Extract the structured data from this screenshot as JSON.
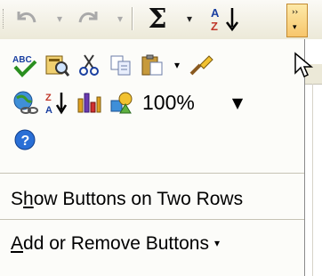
{
  "toolbar": {
    "undo_icon": "undo-icon",
    "redo_icon": "redo-icon",
    "dropdown_glyph": "▾",
    "sigma_label": "Σ",
    "sort_icon": "sort-az-icon",
    "overflow_icon": "toolbar-options-chevron-icon",
    "overflow_top": "››",
    "overflow_bottom": "▾"
  },
  "popup": {
    "row1": [
      "spelling-icon",
      "research-icon",
      "cut-icon",
      "copy-icon",
      "paste-icon",
      "format-painter-icon"
    ],
    "row2": [
      "hyperlink-icon",
      "sort-descending-icon",
      "chart-wizard-icon",
      "drawing-icon"
    ],
    "zoom_value": "100%",
    "zoom_dropdown": "▼",
    "row3": [
      "help-icon"
    ],
    "show_two_rows": {
      "pre": "S",
      "ul": "h",
      "post": "ow Buttons on Two Rows"
    },
    "add_remove": {
      "pre": "",
      "ul": "A",
      "post": "dd or Remove Buttons",
      "arrow": "▾"
    }
  },
  "colors": {
    "toolbar_bg": "#ece9d8",
    "menu_bg": "#fcfcf9",
    "hover": "#f7c66c"
  }
}
